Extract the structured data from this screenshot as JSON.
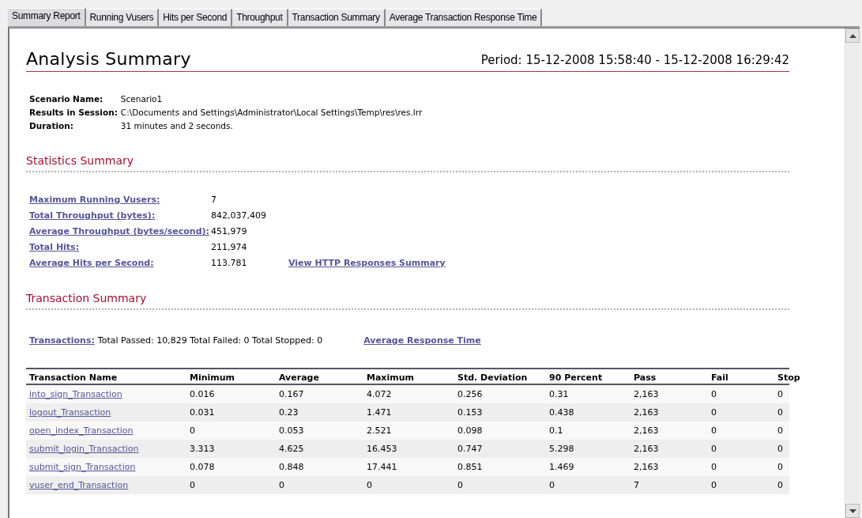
{
  "tabs": [
    {
      "label": "Summary Report",
      "selected": true
    },
    {
      "label": "Running Vusers",
      "selected": false
    },
    {
      "label": "Hits per Second",
      "selected": false
    },
    {
      "label": "Throughput",
      "selected": false
    },
    {
      "label": "Transaction Summary",
      "selected": false
    },
    {
      "label": "Average Transaction Response Time",
      "selected": false
    }
  ],
  "report": {
    "title": "Analysis Summary",
    "period": "Period: 15-12-2008 15:58:40 - 15-12-2008 16:29:42",
    "info": [
      {
        "label": "Scenario Name:",
        "value": "Scenario1"
      },
      {
        "label": "Results in Session:",
        "value": "C:\\Documents and Settings\\Administrator\\Local Settings\\Temp\\res\\res.lrr"
      },
      {
        "label": "Duration:",
        "value": "31 minutes and 2 seconds."
      }
    ],
    "statistics": {
      "heading": "Statistics Summary",
      "rows": [
        {
          "label": "Maximum Running Vusers:",
          "value": "7"
        },
        {
          "label": "Total Throughput (bytes):",
          "value": "842,037,409"
        },
        {
          "label": "Average Throughput (bytes/second):",
          "value": "451,979"
        },
        {
          "label": "Total Hits:",
          "value": "211,974"
        },
        {
          "label": "Average Hits per Second:",
          "value": "113.781",
          "link": "View HTTP Responses Summary"
        }
      ]
    },
    "transactions": {
      "heading": "Transaction Summary",
      "link": "Transactions:",
      "totals": "Total Passed: 10,829 Total Failed: 0 Total Stopped: 0",
      "side_link": "Average Response Time",
      "table": {
        "columns": [
          "Transaction Name",
          "Minimum",
          "Average",
          "Maximum",
          "Std. Deviation",
          "90 Percent",
          "Pass",
          "Fail",
          "Stop"
        ],
        "rows": [
          [
            "into_sign_Transaction",
            "0.016",
            "0.167",
            "4.072",
            "0.256",
            "0.31",
            "2,163",
            "0",
            "0"
          ],
          [
            "logout_Transaction",
            "0.031",
            "0.23",
            "1.471",
            "0.153",
            "0.438",
            "2,163",
            "0",
            "0"
          ],
          [
            "open_index_Transaction",
            "0",
            "0.053",
            "2.521",
            "0.098",
            "0.1",
            "2,163",
            "0",
            "0"
          ],
          [
            "submit_login_Transaction",
            "3.313",
            "4.625",
            "16.453",
            "0.747",
            "5.298",
            "2,163",
            "0",
            "0"
          ],
          [
            "submit_sign_Transaction",
            "0.078",
            "0.848",
            "17.441",
            "0.851",
            "1.469",
            "2,163",
            "0",
            "0"
          ],
          [
            "vuser_end_Transaction",
            "0",
            "0",
            "0",
            "0",
            "0",
            "7",
            "0",
            "0"
          ]
        ]
      }
    }
  }
}
